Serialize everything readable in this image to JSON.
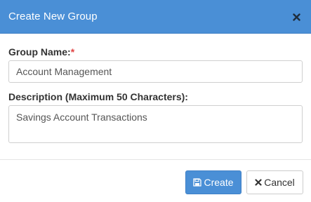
{
  "modal": {
    "title": "Create New Group",
    "close_icon": "close-icon"
  },
  "form": {
    "group_name": {
      "label": "Group Name:",
      "required_mark": "*",
      "value": "Account Management"
    },
    "description": {
      "label": "Description (Maximum 50 Characters):",
      "value": "Savings Account Transactions"
    }
  },
  "footer": {
    "create_label": "Create",
    "create_icon": "save-icon",
    "cancel_label": "Cancel",
    "cancel_icon": "close-icon"
  },
  "colors": {
    "accent": "#4a8fd6",
    "required": "#e04444"
  }
}
